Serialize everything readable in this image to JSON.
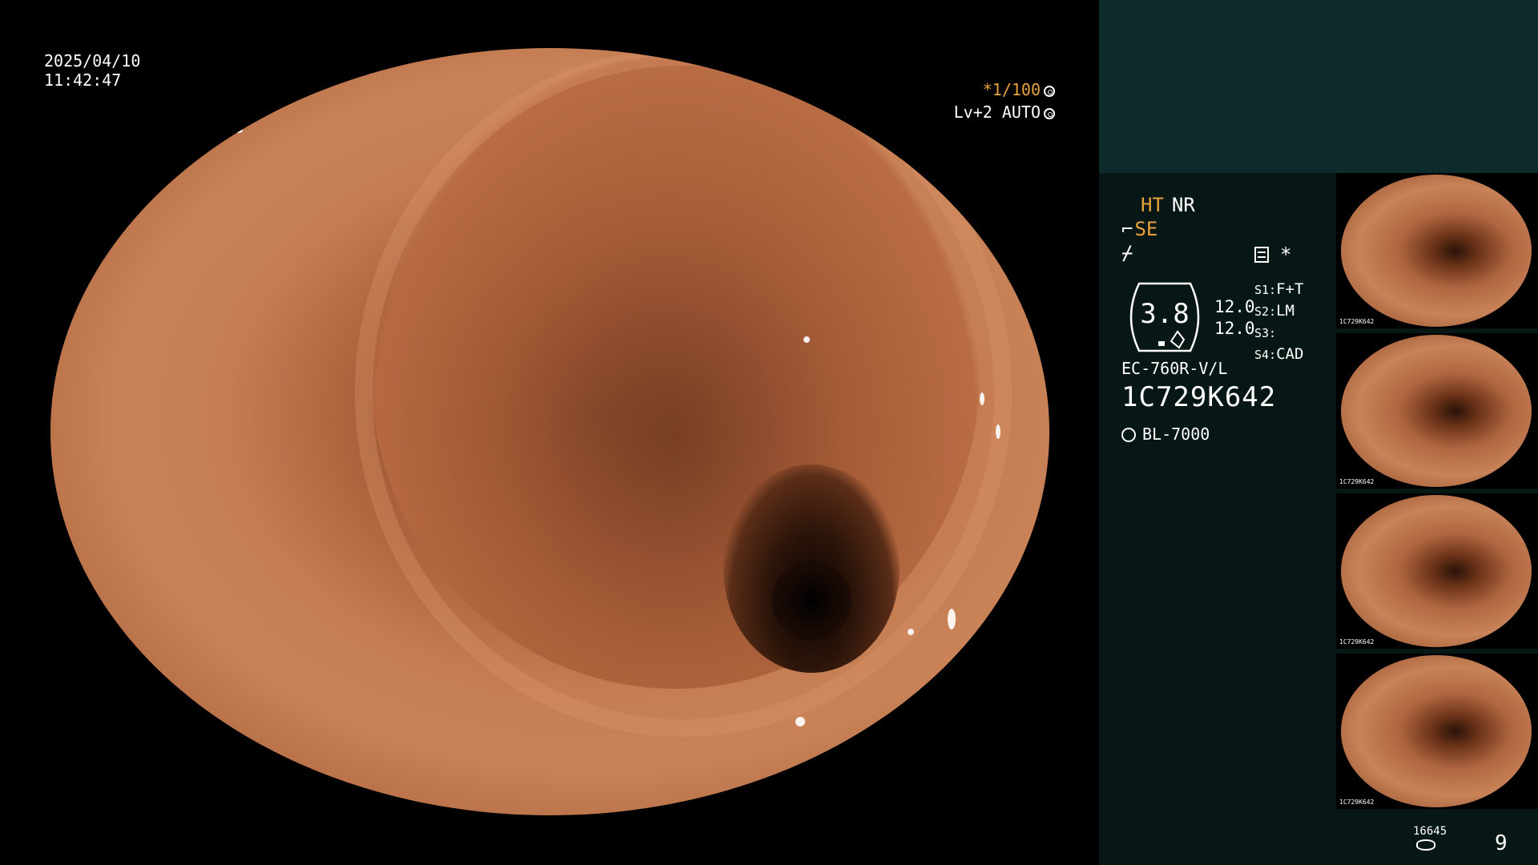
{
  "overlay": {
    "date": "2025/04/10",
    "time": "11:42:47",
    "shutter": "*1/100",
    "level": "Lv+2 AUTO"
  },
  "panel": {
    "mode_ht": "HT",
    "mode_nr": "NR",
    "se_symbol": "⌐",
    "se_label": "SE",
    "f_symbol": "⌿",
    "star": "*",
    "gauge_value": "3.8",
    "gauge_nums": [
      "12.0",
      "12.0"
    ],
    "slots": [
      {
        "key": "S1:",
        "value": "F+T"
      },
      {
        "key": "S2:",
        "value": "LM"
      },
      {
        "key": "S3:",
        "value": ""
      },
      {
        "key": "S4:",
        "value": "CAD"
      }
    ],
    "scope_model": "EC-760R-V/L",
    "serial": "1C729K642",
    "light_source": "BL-7000"
  },
  "thumbnails": [
    {
      "label": "1C729K642"
    },
    {
      "label": "1C729K642"
    },
    {
      "label": "1C729K642"
    },
    {
      "label": "1C729K642"
    }
  ],
  "footer": {
    "count": "16645",
    "page": "9"
  },
  "colors": {
    "accent": "#e8a23a",
    "panel_top": "#0e2b2c",
    "panel": "#071716"
  }
}
